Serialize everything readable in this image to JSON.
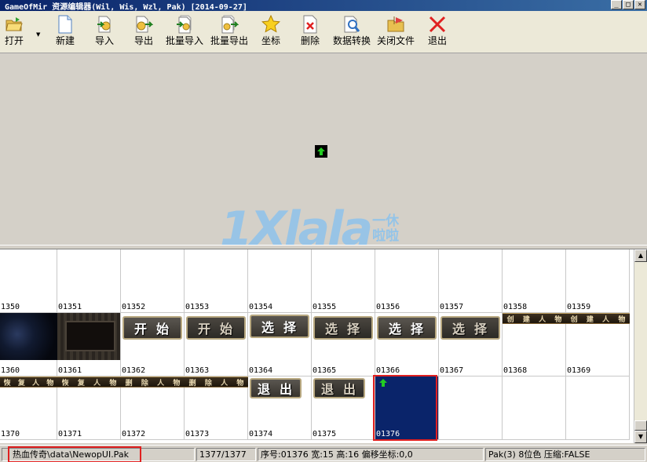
{
  "window": {
    "title": "GameOfMir 资源编辑器(Wil, Wis, Wzl, Pak) [2014-09-27]"
  },
  "toolbar": {
    "open": "打开",
    "new": "新建",
    "import": "导入",
    "export": "导出",
    "batch_import": "批量导入",
    "batch_export": "批量导出",
    "coordinates": "坐标",
    "delete": "删除",
    "data_convert": "数据转换",
    "close_file": "关闭文件",
    "exit": "退出"
  },
  "watermark": {
    "main": "1Xlala",
    "side_top": "一休",
    "side_bottom": "啦啦"
  },
  "grid": {
    "row1": [
      "1350",
      "01351",
      "01352",
      "01353",
      "01354",
      "01355",
      "01356",
      "01357",
      "01358",
      "01359"
    ],
    "row2": [
      "1360",
      "01361",
      "01362",
      "01363",
      "01364",
      "01365",
      "01366",
      "01367",
      "01368",
      "01369"
    ],
    "row3": [
      "1370",
      "01371",
      "01372",
      "01373",
      "01374",
      "01375",
      "01376",
      "",
      "",
      ""
    ],
    "images": {
      "start": [
        "开",
        "始"
      ],
      "select": [
        "选",
        "择"
      ],
      "exit": [
        "退",
        "出"
      ],
      "create_char": [
        "创",
        "建",
        "人",
        "物"
      ],
      "restore_char": [
        "恢",
        "复",
        "人",
        "物"
      ],
      "delete_char": [
        "删",
        "除",
        "人",
        "物"
      ]
    }
  },
  "status": {
    "path": "热血传奇\\data\\NewopUI.Pak",
    "count": "1377/1377",
    "info": "序号:01376 宽:15 高:16 偏移坐标:0,0",
    "format": "Pak(3) 8位色 压缩:FALSE"
  },
  "colors": {
    "accent": "#0a246a",
    "highlight": "#e02020",
    "arrow": "#22aa22"
  }
}
